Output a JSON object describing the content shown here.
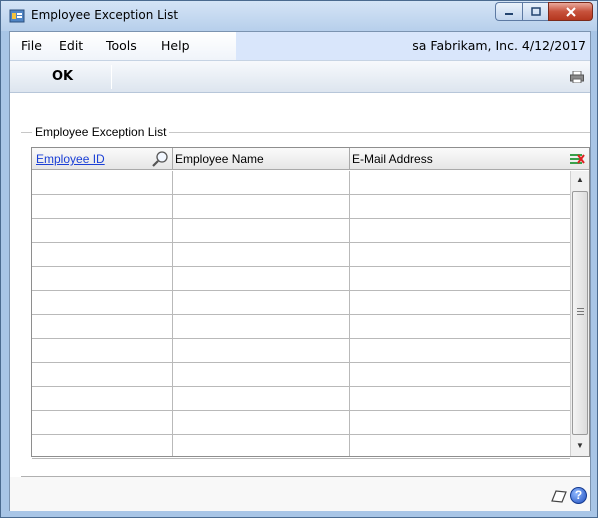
{
  "window": {
    "title": "Employee Exception List"
  },
  "menu": {
    "items": [
      "File",
      "Edit",
      "Tools",
      "Help"
    ]
  },
  "company": {
    "text": "sa  Fabrikam, Inc.  4/12/2017"
  },
  "toolbar": {
    "ok_label": "OK"
  },
  "group": {
    "label": "Employee Exception List"
  },
  "grid": {
    "columns": [
      "Employee ID",
      "Employee Name",
      "E-Mail Address"
    ],
    "rows": [
      [
        "",
        "",
        ""
      ],
      [
        "",
        "",
        ""
      ],
      [
        "",
        "",
        ""
      ],
      [
        "",
        "",
        ""
      ],
      [
        "",
        "",
        ""
      ],
      [
        "",
        "",
        ""
      ],
      [
        "",
        "",
        ""
      ],
      [
        "",
        "",
        ""
      ],
      [
        "",
        "",
        ""
      ],
      [
        "",
        "",
        ""
      ],
      [
        "",
        "",
        ""
      ],
      [
        "",
        "",
        ""
      ]
    ]
  },
  "icons": {
    "app": "app-icon",
    "lookup": "lookup-magnifier-icon",
    "expand": "expand-columns-icon",
    "print": "printer-icon",
    "note": "note-icon",
    "help": "help-icon"
  },
  "colors": {
    "link": "#1a3fd6",
    "close_button": "#c7523c"
  }
}
